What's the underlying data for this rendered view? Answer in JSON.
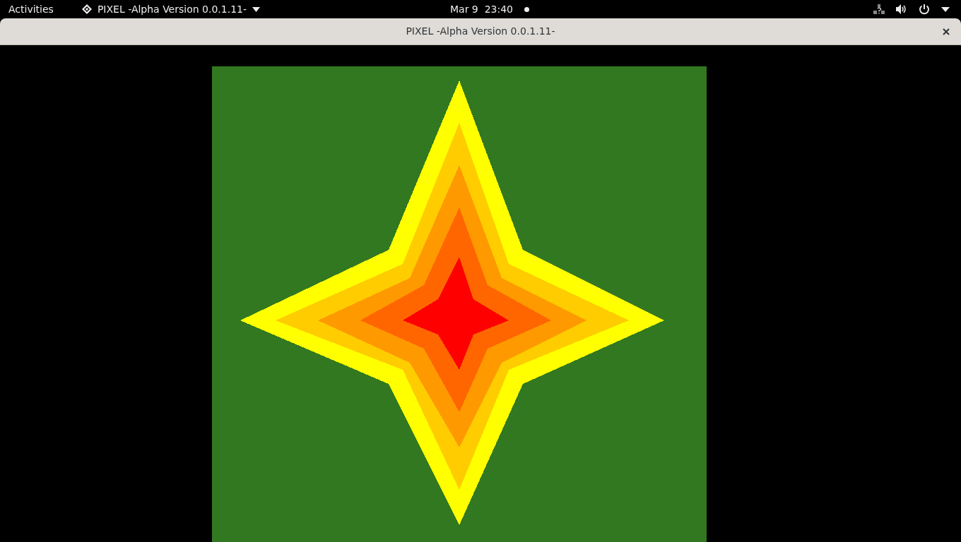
{
  "top_bar": {
    "activities": "Activities",
    "app_menu": "PIXEL -Alpha Version 0.0.1.11-",
    "clock": "Mar 9  23:40",
    "notification_dot": true
  },
  "window": {
    "title": "PIXEL -Alpha Version 0.0.1.11-"
  }
}
